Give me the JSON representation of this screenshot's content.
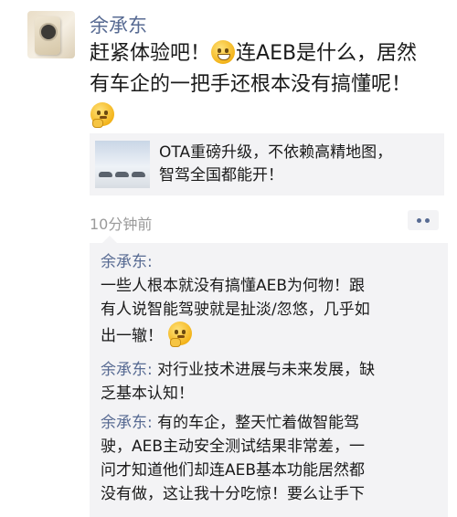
{
  "post": {
    "author": "余承东",
    "text_line1_a": "赶紧体验吧！",
    "text_line1_b": "连AEB是什么，居然",
    "text_line2": "有车企的一把手还根本没有搞懂呢！",
    "emoji_1": "grinning-emoji",
    "emoji_2": "thinking-emoji"
  },
  "link_card": {
    "line1": "OTA重磅升级，不依赖高精地图，",
    "line2": "智驾全国都能开！"
  },
  "meta": {
    "timestamp": "10分钟前",
    "more_icon": "more-dots-icon"
  },
  "comments": [
    {
      "author": "余承东:",
      "lines": [
        "一些人根本就没有搞懂AEB为何物！跟",
        "有人说智能驾驶就是扯淡/忽悠，几乎如",
        "出一辙！"
      ],
      "emoji": "thinking-emoji"
    },
    {
      "author": "余承东:",
      "first": "对行业技术进展与未来发展，缺",
      "second": "乏基本认知！"
    },
    {
      "author": "余承东:",
      "first": "有的车企，整天忙着做智能驾",
      "lines": [
        "驶，AEB主动安全测试结果非常差，一",
        "问才知道他们却连AEB基本功能居然都",
        "没有做，这让我十分吃惊！要么让手下"
      ]
    }
  ]
}
